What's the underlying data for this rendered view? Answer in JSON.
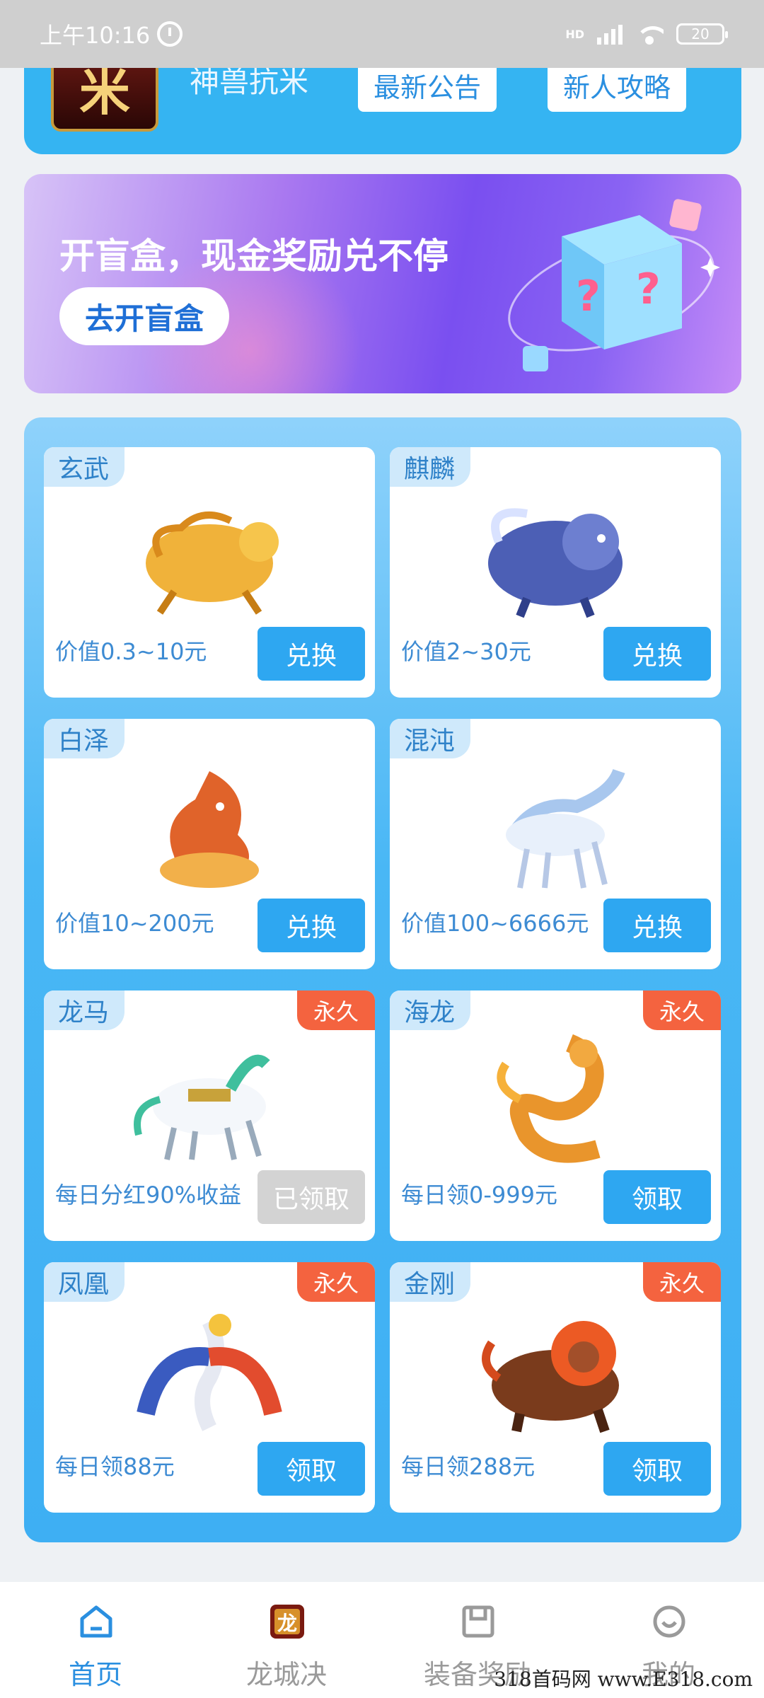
{
  "status_bar": {
    "time": "上午10:16",
    "network": "HD",
    "battery": "20"
  },
  "header": {
    "logo_text": "米",
    "app_name": "神兽抗米",
    "notice_button": "最新公告",
    "guide_button": "新人攻略"
  },
  "banner": {
    "title": "开盲盒，现金奖励兑不停",
    "button": "去开盲盒"
  },
  "cards": [
    {
      "name": "玄武",
      "tag": "",
      "value": "价值0.3~10元",
      "button": "兑换",
      "button_state": "active"
    },
    {
      "name": "麒麟",
      "tag": "",
      "value": "价值2~30元",
      "button": "兑换",
      "button_state": "active"
    },
    {
      "name": "白泽",
      "tag": "",
      "value": "价值10~200元",
      "button": "兑换",
      "button_state": "active"
    },
    {
      "name": "混沌",
      "tag": "",
      "value": "价值100~6666元",
      "button": "兑换",
      "button_state": "active"
    },
    {
      "name": "龙马",
      "tag": "永久",
      "value": "每日分红90%收益",
      "button": "已领取",
      "button_state": "disabled"
    },
    {
      "name": "海龙",
      "tag": "永久",
      "value": "每日领0-999元",
      "button": "领取",
      "button_state": "active"
    },
    {
      "name": "凤凰",
      "tag": "永久",
      "value": "每日领88元",
      "button": "领取",
      "button_state": "active"
    },
    {
      "name": "金刚",
      "tag": "永久",
      "value": "每日领288元",
      "button": "领取",
      "button_state": "active"
    }
  ],
  "bottom_nav": [
    {
      "label": "首页",
      "icon": "home-icon",
      "active": true
    },
    {
      "label": "龙城决",
      "icon": "game-logo-icon",
      "active": false
    },
    {
      "label": "装备奖励",
      "icon": "bag-icon",
      "active": false
    },
    {
      "label": "我的",
      "icon": "profile-icon",
      "active": false
    }
  ],
  "watermark": "318首码网 www.E318.com",
  "colors": {
    "primary": "#35b4f2",
    "button": "#2ea7f1",
    "tag": "#f4633f",
    "disabled": "#d3d3d3"
  }
}
